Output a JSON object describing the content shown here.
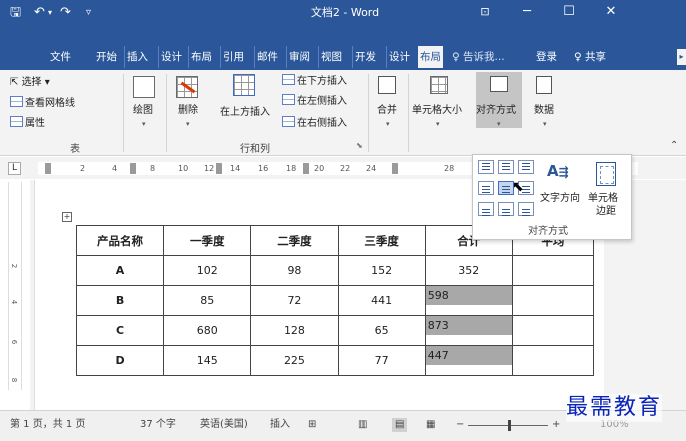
{
  "titlebar": {
    "title": "文档2 - Word",
    "save_icon": "save-icon",
    "undo_icon": "undo-icon",
    "redo_icon": "redo-icon",
    "customize_icon": "customize-qat-icon",
    "ribbon_display_icon": "ribbon-display-icon",
    "minimize_glyph": "─",
    "maximize_glyph": "☐",
    "close_glyph": "✕"
  },
  "tabs": [
    {
      "label": "文件"
    },
    {
      "label": "开始"
    },
    {
      "label": "插入"
    },
    {
      "label": "设计"
    },
    {
      "label": "布局"
    },
    {
      "label": "引用"
    },
    {
      "label": "邮件"
    },
    {
      "label": "审阅"
    },
    {
      "label": "视图"
    },
    {
      "label": "开发"
    },
    {
      "label": "设计"
    },
    {
      "label": "布局",
      "active": true
    }
  ],
  "tellme": "♀ 告诉我...",
  "login": "登录",
  "share": "♀ 共享",
  "ribbon": {
    "select": "选择",
    "view_gridlines": "查看网格线",
    "properties": "属性",
    "draw": "绘图",
    "delete": "删除",
    "insert_above": "在上方插入",
    "insert_below": "在下方插入",
    "insert_left": "在左侧插入",
    "insert_right": "在右侧插入",
    "merge": "合并",
    "cell_size": "单元格大小",
    "alignment": "对齐方式",
    "data": "数据",
    "group_table": "表",
    "group_rows_cols": "行和列"
  },
  "ruler": {
    "ticks": [
      "2",
      "4",
      "8",
      "10",
      "12",
      "14",
      "16",
      "18",
      "20",
      "22",
      "24",
      "28"
    ],
    "vticks": [
      "2",
      "4",
      "6",
      "8"
    ],
    "tab_selector": "L"
  },
  "alignment_panel": {
    "text_direction": "文字方向",
    "cell_margins_line1": "单元格",
    "cell_margins_line2": "边距",
    "title": "对齐方式",
    "glyph_text_direction": "A",
    "hover_cell": "middle-center"
  },
  "table": {
    "headers": [
      "产品名称",
      "一季度",
      "二季度",
      "三季度",
      "合计",
      "平均"
    ],
    "rows": [
      [
        "A",
        "102",
        "98",
        "152",
        "352",
        ""
      ],
      [
        "B",
        "85",
        "72",
        "441",
        "598",
        ""
      ],
      [
        "C",
        "680",
        "128",
        "65",
        "873",
        ""
      ],
      [
        "D",
        "145",
        "225",
        "77",
        "447",
        ""
      ]
    ]
  },
  "statusbar": {
    "page": "第 1 页，共 1 页",
    "words": "37 个字",
    "language": "英语(美国)",
    "mode": "插入",
    "zoom": "100%"
  },
  "watermark": "最需教育"
}
